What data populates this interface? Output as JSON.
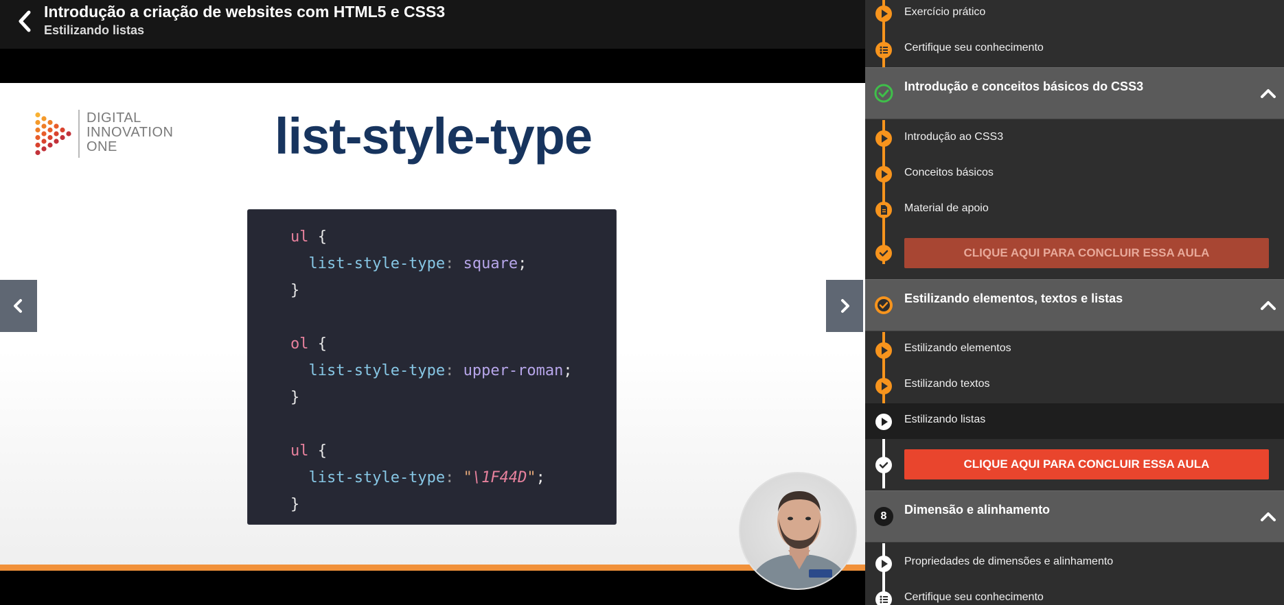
{
  "header": {
    "course_title": "Introdução a criação de websites com HTML5 e CSS3",
    "lesson_title": "Estilizando listas"
  },
  "slide": {
    "logo": {
      "line1": "DIGITAL",
      "line2": "INNOVATION",
      "line3": "ONE"
    },
    "heading": "list-style-type",
    "code": [
      [
        {
          "t": "ul",
          "c": "sel"
        },
        {
          "t": " {",
          "c": "brace"
        }
      ],
      [
        {
          "t": "  list-style-type",
          "c": "prop"
        },
        {
          "t": ":",
          "c": "punct"
        },
        {
          "t": " square",
          "c": "val"
        },
        {
          "t": ";",
          "c": "brace"
        }
      ],
      [
        {
          "t": "}",
          "c": "brace"
        }
      ],
      [],
      [
        {
          "t": "ol",
          "c": "sel"
        },
        {
          "t": " {",
          "c": "brace"
        }
      ],
      [
        {
          "t": "  list-style-type",
          "c": "prop"
        },
        {
          "t": ":",
          "c": "punct"
        },
        {
          "t": " upper-roman",
          "c": "val"
        },
        {
          "t": ";",
          "c": "brace"
        }
      ],
      [
        {
          "t": "}",
          "c": "brace"
        }
      ],
      [],
      [
        {
          "t": "ul",
          "c": "sel"
        },
        {
          "t": " {",
          "c": "brace"
        }
      ],
      [
        {
          "t": "  list-style-type",
          "c": "prop"
        },
        {
          "t": ":",
          "c": "punct"
        },
        {
          "t": " \"",
          "c": "str"
        },
        {
          "t": "\\1F44D",
          "c": "esc"
        },
        {
          "t": "\"",
          "c": "str"
        },
        {
          "t": ";",
          "c": "brace"
        }
      ],
      [
        {
          "t": "}",
          "c": "brace"
        }
      ]
    ]
  },
  "sidebar": {
    "top_items": [
      {
        "label": "Exercício prático",
        "icon": "play-icon"
      },
      {
        "label": "Certifique seu conhecimento",
        "icon": "list-icon"
      }
    ],
    "sections": [
      {
        "title": "Introdução e conceitos básicos do CSS3",
        "status": "completed",
        "items": [
          {
            "label": "Introdução ao CSS3",
            "icon": "play-icon"
          },
          {
            "label": "Conceitos básicos",
            "icon": "play-icon"
          },
          {
            "label": "Material de apoio",
            "icon": "document-icon"
          }
        ],
        "conclude_label": "CLIQUE AQUI PARA CONCLUIR ESSA AULA"
      },
      {
        "title": "Estilizando elementos, textos e listas",
        "status": "in-progress",
        "items": [
          {
            "label": "Estilizando elementos",
            "icon": "play-icon"
          },
          {
            "label": "Estilizando textos",
            "icon": "play-icon"
          },
          {
            "label": "Estilizando listas",
            "icon": "play-icon",
            "active": true
          }
        ],
        "conclude_label": "CLIQUE AQUI PARA CONCLUIR ESSA AULA"
      },
      {
        "title": "Dimensão e alinhamento",
        "number": "8",
        "items": [
          {
            "label": "Propriedades de dimensões e alinhamento",
            "icon": "play-icon"
          },
          {
            "label": "Certifique seu conhecimento",
            "icon": "list-icon"
          }
        ]
      }
    ]
  },
  "colors": {
    "accent": "#f7941d",
    "conclude_active": "#e9452d",
    "conclude_dim": "#a84633",
    "slide_heading": "#17345e",
    "completed_check": "#3fbf4a"
  }
}
